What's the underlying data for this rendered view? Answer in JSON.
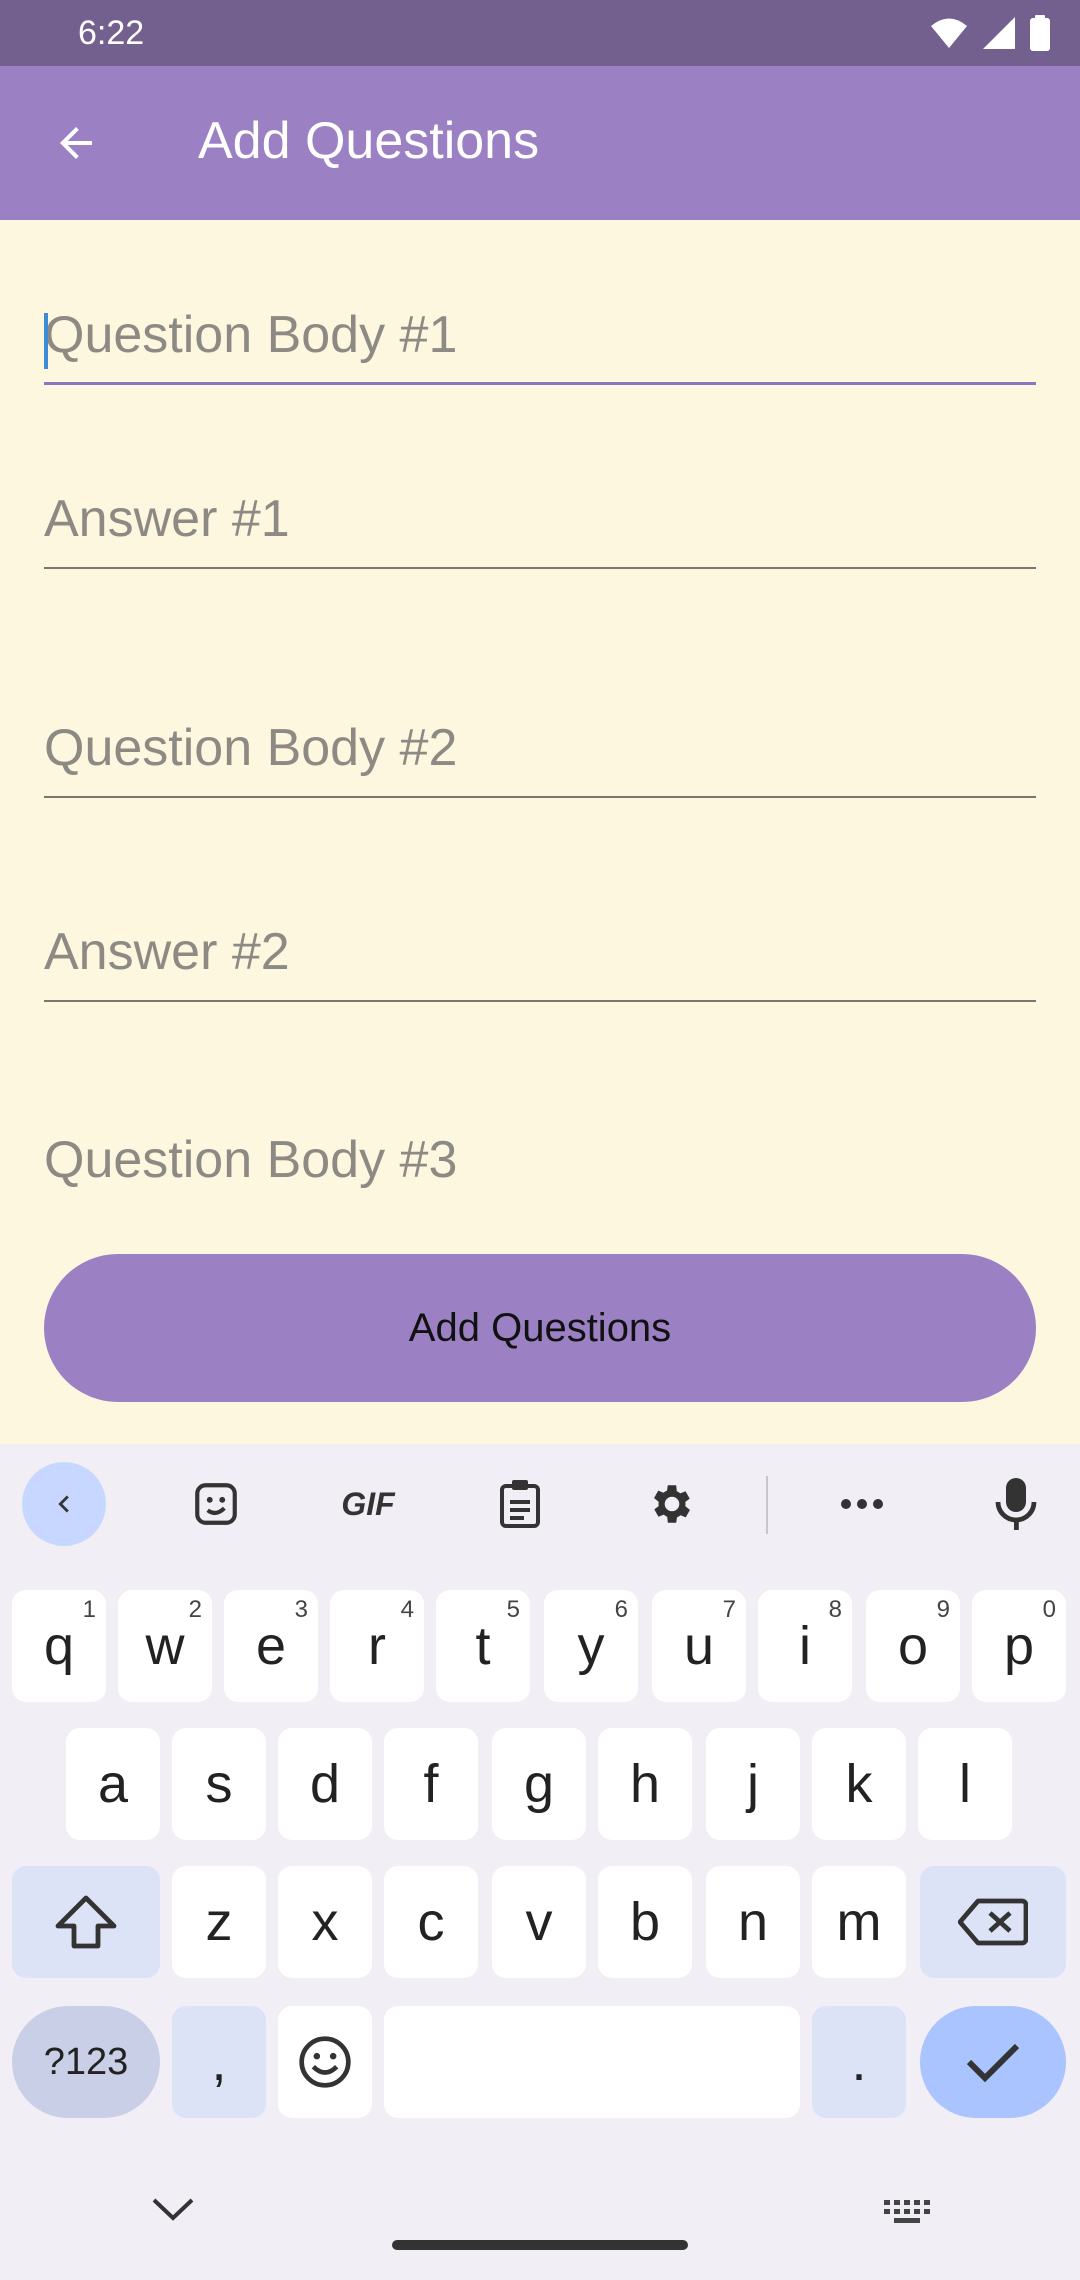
{
  "status_bar": {
    "time": "6:22",
    "icons": [
      "wifi-icon",
      "signal-icon",
      "battery-icon"
    ]
  },
  "app_bar": {
    "title": "Add Questions",
    "back_icon": "arrow-back-icon"
  },
  "form": {
    "fields": [
      {
        "placeholder": "Question Body #1",
        "value": "",
        "focused": true
      },
      {
        "placeholder": "Answer #1",
        "value": ""
      },
      {
        "placeholder": "Question Body #2",
        "value": ""
      },
      {
        "placeholder": "Answer #2",
        "value": ""
      },
      {
        "placeholder": "Question Body #3",
        "value": ""
      }
    ],
    "submit_label": "Add Questions"
  },
  "keyboard": {
    "toolbar": [
      "chevron-left-icon",
      "sticker-icon",
      "gif-icon",
      "clipboard-icon",
      "settings-icon",
      "more-icon",
      "mic-icon"
    ],
    "gif_label": "GIF",
    "row1": [
      {
        "k": "q",
        "h": "1"
      },
      {
        "k": "w",
        "h": "2"
      },
      {
        "k": "e",
        "h": "3"
      },
      {
        "k": "r",
        "h": "4"
      },
      {
        "k": "t",
        "h": "5"
      },
      {
        "k": "y",
        "h": "6"
      },
      {
        "k": "u",
        "h": "7"
      },
      {
        "k": "i",
        "h": "8"
      },
      {
        "k": "o",
        "h": "9"
      },
      {
        "k": "p",
        "h": "0"
      }
    ],
    "row2": [
      "a",
      "s",
      "d",
      "f",
      "g",
      "h",
      "j",
      "k",
      "l"
    ],
    "row3": [
      "z",
      "x",
      "c",
      "v",
      "b",
      "n",
      "m"
    ],
    "symbols_label": "?123",
    "comma": ",",
    "period": ".",
    "shift_icon": "shift-icon",
    "backspace_icon": "backspace-icon",
    "emoji_icon": "emoji-icon",
    "enter_icon": "checkmark-icon"
  },
  "nav_bar": {
    "left_icon": "chevron-down-icon",
    "right_icon": "keyboard-icon"
  }
}
